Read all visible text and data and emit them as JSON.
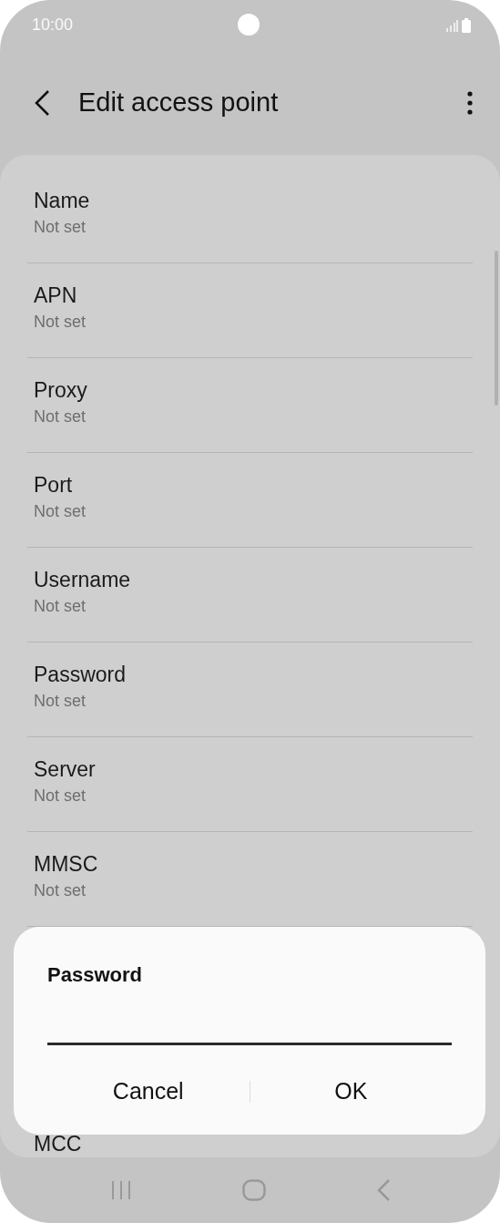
{
  "status_bar": {
    "time": "10:00"
  },
  "header": {
    "title": "Edit access point"
  },
  "settings": [
    {
      "label": "Name",
      "value": "Not set"
    },
    {
      "label": "APN",
      "value": "Not set"
    },
    {
      "label": "Proxy",
      "value": "Not set"
    },
    {
      "label": "Port",
      "value": "Not set"
    },
    {
      "label": "Username",
      "value": "Not set"
    },
    {
      "label": "Password",
      "value": "Not set"
    },
    {
      "label": "Server",
      "value": "Not set"
    },
    {
      "label": "MMSC",
      "value": "Not set"
    }
  ],
  "partial_item": {
    "label": "MCC"
  },
  "dialog": {
    "title": "Password",
    "buttons": [
      "Cancel",
      "OK"
    ]
  }
}
